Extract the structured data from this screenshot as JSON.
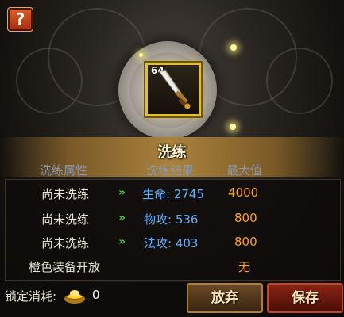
{
  "help_button": {
    "label": "?"
  },
  "item": {
    "level": "64",
    "icon": "sword-icon"
  },
  "panel": {
    "title": "洗练",
    "headers": {
      "attribute": "洗练属性",
      "result": "洗练结果",
      "max": "最大值"
    },
    "rows": [
      {
        "status": "尚未洗练",
        "arrow": "»",
        "attr_name": "生命",
        "attr_value": "2745",
        "max": "4000"
      },
      {
        "status": "尚未洗练",
        "arrow": "»",
        "attr_name": "物攻",
        "attr_value": "536",
        "max": "800"
      },
      {
        "status": "尚未洗练",
        "arrow": "»",
        "attr_name": "法攻",
        "attr_value": "403",
        "max": "800"
      }
    ],
    "orange_row": {
      "label": "橙色装备开放",
      "value": "无"
    }
  },
  "footer": {
    "lock_label": "锁定消耗:",
    "lock_cost": "0",
    "currency_icon": "gold-ingot-icon",
    "abandon_label": "放弃",
    "save_label": "保存"
  },
  "colors": {
    "status": "#e8e2d4",
    "attr": "#5fb0ff",
    "max": "#ffa21a",
    "arrow": "#3ec23a",
    "slot_border": "#e0c030"
  }
}
